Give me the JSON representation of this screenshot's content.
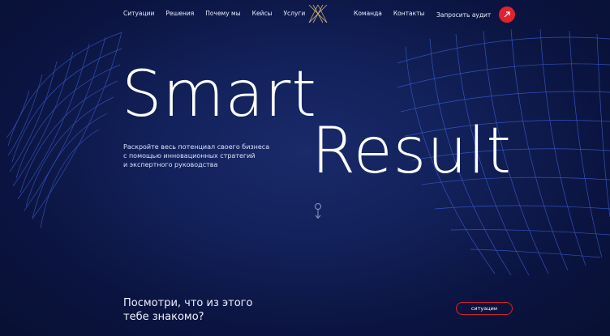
{
  "nav": {
    "left": [
      "Ситуации",
      "Решения",
      "Почему мы",
      "Кейсы",
      "Услуги"
    ],
    "right": [
      "Команда",
      "Контакты"
    ]
  },
  "cta": {
    "label": "Запросить аудит",
    "icon": "arrow-up-right-icon",
    "color": "#e0232e"
  },
  "hero": {
    "line1": "Smart",
    "line2": "Result",
    "subtitle": [
      "Раскройте весь потенциал своего бизнеса",
      "с помощью инновационных стратегий",
      "и экспертного руководства"
    ]
  },
  "section": {
    "question_lines": [
      "Посмотри, что из этого",
      "тебе знакомо?"
    ],
    "pill_label": "ситуации"
  },
  "colors": {
    "background": "#0b1440",
    "accent": "#e0232e",
    "mesh": "#3b5bd6"
  }
}
